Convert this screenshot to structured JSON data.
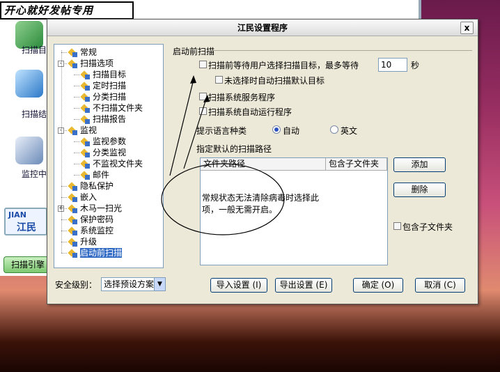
{
  "banner": "开心就好发帖专用",
  "bg_sidebar": [
    "扫描目",
    "扫描结",
    "监控中"
  ],
  "brand": {
    "line1": "JIAN",
    "line2": "江民"
  },
  "engine_tab": "扫描引擎",
  "dialog": {
    "title": "江民设置程序",
    "close": "x",
    "tree": [
      {
        "label": "常规",
        "level": 0,
        "expander": ""
      },
      {
        "label": "扫描选项",
        "level": 0,
        "expander": "-"
      },
      {
        "label": "扫描目标",
        "level": 1,
        "expander": ""
      },
      {
        "label": "定时扫描",
        "level": 1,
        "expander": ""
      },
      {
        "label": "分类扫描",
        "level": 1,
        "expander": ""
      },
      {
        "label": "不扫描文件夹",
        "level": 1,
        "expander": ""
      },
      {
        "label": "扫描报告",
        "level": 1,
        "expander": ""
      },
      {
        "label": "监视",
        "level": 0,
        "expander": "-"
      },
      {
        "label": "监视参数",
        "level": 1,
        "expander": ""
      },
      {
        "label": "分类监视",
        "level": 1,
        "expander": ""
      },
      {
        "label": "不监视文件夹",
        "level": 1,
        "expander": ""
      },
      {
        "label": "邮件",
        "level": 1,
        "expander": ""
      },
      {
        "label": "隐私保护",
        "level": 0,
        "expander": ""
      },
      {
        "label": "嵌入",
        "level": 0,
        "expander": ""
      },
      {
        "label": "木马一扫光",
        "level": 0,
        "expander": "+"
      },
      {
        "label": "保护密码",
        "level": 0,
        "expander": ""
      },
      {
        "label": "系统监控",
        "level": 0,
        "expander": ""
      },
      {
        "label": "升级",
        "level": 0,
        "expander": ""
      },
      {
        "label": "启动前扫描",
        "level": 0,
        "expander": "",
        "selected": true
      }
    ],
    "section_title": "启动前扫描",
    "wait_label": "扫描前等待用户选择扫描目标，最多等待",
    "wait_value": "10",
    "wait_unit": "秒",
    "auto_default": "未选择时自动扫描默认目标",
    "scan_services": "扫描系统服务程序",
    "scan_autorun": "扫描系统自动运行程序",
    "lang_label": "提示语言种类",
    "lang_auto": "自动",
    "lang_en": "英文",
    "path_label": "指定默认的扫描路径",
    "col_folder": "文件夹路径",
    "col_sub": "包含子文件夹",
    "btn_add": "添加",
    "btn_delete": "删除",
    "include_sub": "包含子文件夹",
    "annotation": "常规状态无法清除病毒时选择此项，一般无需开启。",
    "security_label": "安全级别：",
    "security_value": "选择预设方案",
    "btn_import": "导入设置 (I)",
    "btn_export": "导出设置 (E)",
    "btn_ok": "确定 (O)",
    "btn_cancel": "取消 (C)"
  }
}
